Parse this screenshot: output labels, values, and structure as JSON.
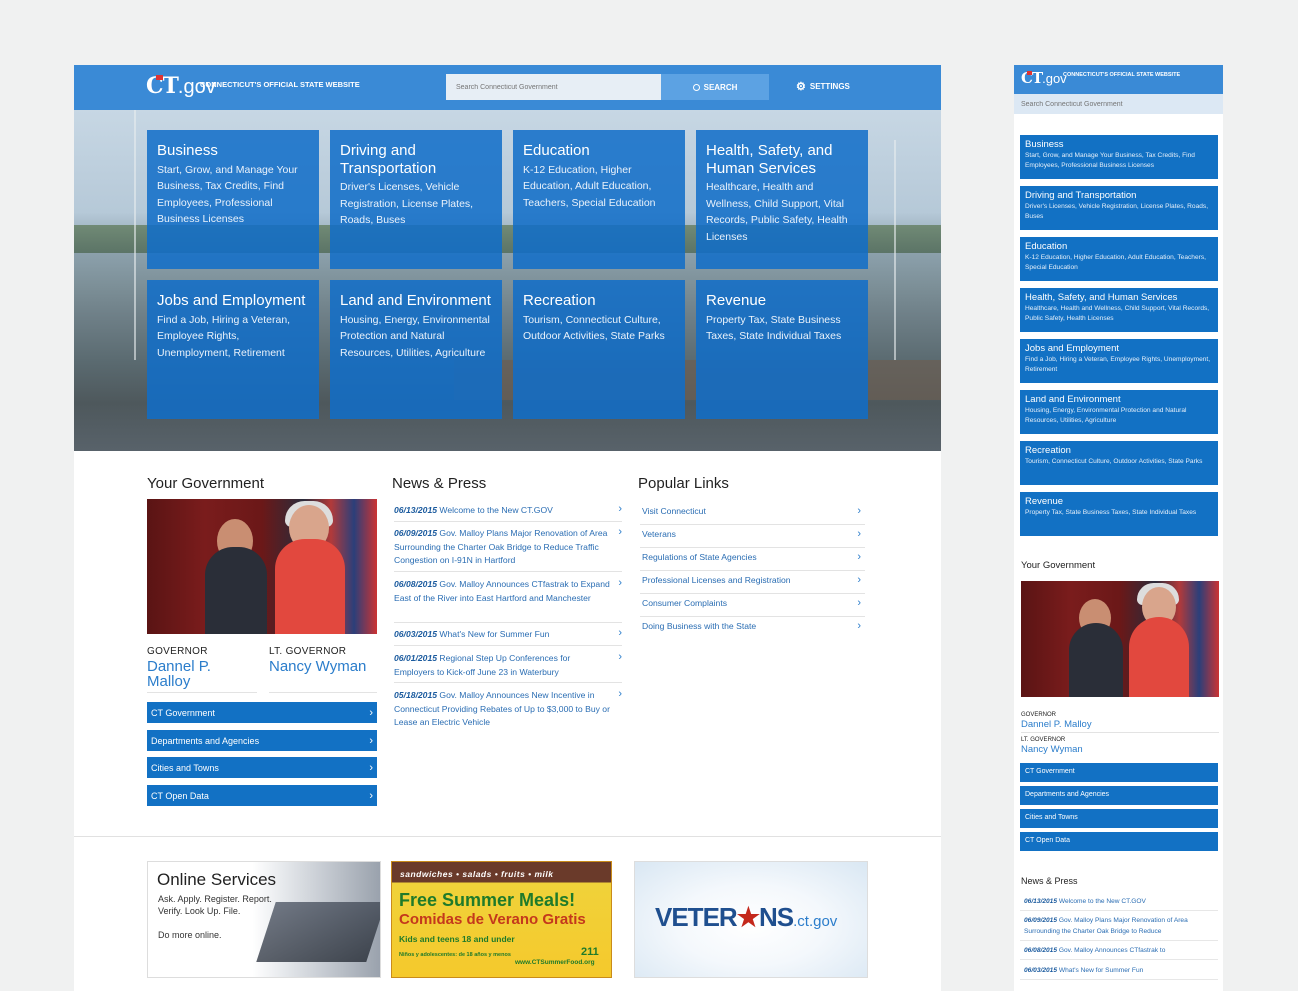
{
  "brand": {
    "logo_ct": "CT",
    "logo_gov": ".gov",
    "tagline": "Connecticut's Official State Website"
  },
  "header": {
    "search_placeholder": "Search Connecticut Government",
    "search_label": "SEARCH",
    "settings_label": "SETTINGS"
  },
  "categories": [
    {
      "title": "Business",
      "desc": "Start, Grow, and Manage Your Business, Tax Credits, Find Employees, Professional Business Licenses"
    },
    {
      "title": "Driving and Transportation",
      "desc": "Driver's Licenses, Vehicle Registration, License Plates, Roads, Buses"
    },
    {
      "title": "Education",
      "desc": "K-12 Education, Higher Education, Adult Education, Teachers, Special Education"
    },
    {
      "title": "Health, Safety, and Human Services",
      "desc": "Healthcare, Health and Wellness, Child Support, Vital Records, Public Safety, Health Licenses"
    },
    {
      "title": "Jobs and Employment",
      "desc": "Find a Job, Hiring a Veteran, Employee Rights, Unemployment, Retirement"
    },
    {
      "title": "Land and Environment",
      "desc": "Housing, Energy, Environmental Protection and Natural Resources, Utilities, Agriculture"
    },
    {
      "title": "Recreation",
      "desc": "Tourism, Connecticut Culture, Outdoor Activities, State Parks"
    },
    {
      "title": "Revenue",
      "desc": "Property Tax, State Business Taxes, State Individual Taxes"
    }
  ],
  "government": {
    "heading": "Your Government",
    "governor_role": "GOVERNOR",
    "governor_name": "Dannel P. Malloy",
    "lt_role": "LT. GOVERNOR",
    "lt_name": "Nancy Wyman",
    "links": [
      "CT Government",
      "Departments and Agencies",
      "Cities and Towns",
      "CT Open Data"
    ]
  },
  "news": {
    "heading": "News & Press",
    "items": [
      {
        "date": "06/13/2015",
        "text": "Welcome to the New CT.GOV"
      },
      {
        "date": "06/09/2015",
        "text": "Gov. Malloy Plans Major Renovation of Area Surrounding the Charter Oak Bridge to Reduce Traffic Congestion on I-91N in Hartford"
      },
      {
        "date": "06/08/2015",
        "text": "Gov. Malloy Announces CTfastrak to Expand East of the River into East Hartford and Manchester"
      },
      {
        "date": "06/03/2015",
        "text": "What's New for Summer Fun"
      },
      {
        "date": "06/01/2015",
        "text": "Regional Step Up Conferences for Employers to Kick-off June 23 in Waterbury"
      },
      {
        "date": "05/18/2015",
        "text": "Gov. Malloy Announces New Incentive in Connecticut Providing Rebates of Up to $3,000 to Buy or Lease an Electric Vehicle"
      }
    ]
  },
  "popular": {
    "heading": "Popular Links",
    "items": [
      "Visit Connecticut",
      "Veterans",
      "Regulations of State Agencies",
      "Professional Licenses and Registration",
      "Consumer Complaints",
      "Doing Business with the State"
    ]
  },
  "banners": {
    "online_title": "Online Services",
    "online_line1": "Ask. Apply. Register. Report.",
    "online_line2": "Verify. Look Up. File.",
    "online_line3": "Do more online.",
    "meals_top": "sandwiches • salads • fruits • milk",
    "meals_title1": "Free Summer Meals!",
    "meals_title2": "Comidas de Verano Gratis",
    "meals_kids": "Kids and teens 18 and under",
    "meals_kids_es": "Niños y adolescentes: de 18 años y menos",
    "meals_211": "211",
    "meals_url": "www.CTSummerFood.org",
    "vet_text_a": "VETER",
    "vet_text_b": "NS",
    "vet_suffix": ".ct.gov"
  },
  "mobile": {
    "search_placeholder": "Search Connecticut Government",
    "tiles": [
      {
        "title": "Business",
        "desc": "Start, Grow, and Manage Your Business, Tax Credits, Find Employees, Professional Business Licenses"
      },
      {
        "title": "Driving and Transportation",
        "desc": "Driver's Licenses, Vehicle Registration, License Plates, Roads, Buses"
      },
      {
        "title": "Education",
        "desc": "K-12 Education, Higher Education, Adult Education, Teachers, Special Education"
      },
      {
        "title": "Health, Safety, and Human Services",
        "desc": "Healthcare, Health and Wellness, Child Support, Vital Records, Public Safety, Health Licenses"
      },
      {
        "title": "Jobs and Employment",
        "desc": "Find a Job, Hiring a Veteran, Employee Rights, Unemployment, Retirement"
      },
      {
        "title": "Land and Environment",
        "desc": "Housing, Energy, Environmental Protection and Natural Resources, Utilities, Agriculture"
      },
      {
        "title": "Recreation",
        "desc": "Tourism, Connecticut Culture, Outdoor Activities, State Parks"
      },
      {
        "title": "Revenue",
        "desc": "Property Tax, State Business Taxes, State Individual Taxes"
      }
    ],
    "gov_heading": "Your Government",
    "governor_role": "GOVERNOR",
    "governor_name": "Dannel P. Malloy",
    "lt_role": "LT. GOVERNOR",
    "lt_name": "Nancy Wyman",
    "gov_links": [
      "CT Government",
      "Departments and Agencies",
      "Cities and Towns",
      "CT Open Data"
    ],
    "news_heading": "News & Press",
    "news": [
      {
        "date": "06/13/2015",
        "text": "Welcome to the New CT.GOV"
      },
      {
        "date": "06/09/2015",
        "text": "Gov. Malloy Plans Major Renovation of Area Surrounding the Charter Oak Bridge to Reduce"
      },
      {
        "date": "06/08/2015",
        "text": "Gov. Malloy Announces CTfastrak to"
      },
      {
        "date": "06/03/2015",
        "text": "What's New for Summer Fun"
      }
    ]
  },
  "colors": {
    "brand_blue": "#3a8ad6",
    "tile_blue": "#1271c4",
    "link_blue": "#2a6db3"
  }
}
